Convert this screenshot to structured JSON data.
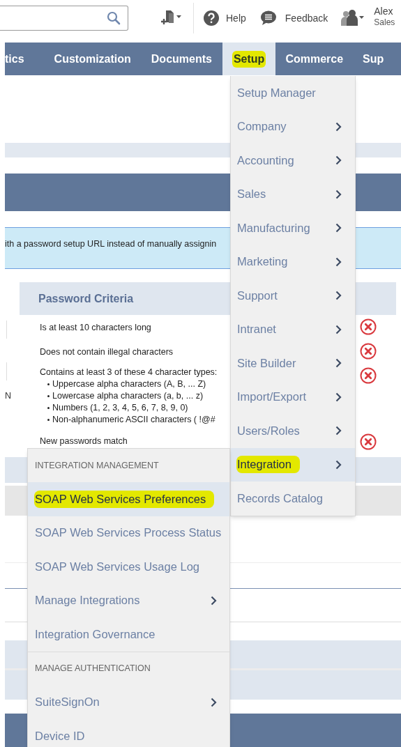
{
  "header": {
    "help_label": "Help",
    "feedback_label": "Feedback",
    "user_name": "Alex",
    "user_account": "Sales"
  },
  "nav": [
    {
      "label": "tics",
      "selected": false,
      "highlighted": false
    },
    {
      "label": "Customization",
      "selected": false,
      "highlighted": false
    },
    {
      "label": "Documents",
      "selected": false,
      "highlighted": false
    },
    {
      "label": "Setup",
      "selected": true,
      "highlighted": true
    },
    {
      "label": "Commerce",
      "selected": false,
      "highlighted": false
    },
    {
      "label": "Sup",
      "selected": false,
      "highlighted": false
    }
  ],
  "notice": {
    "text": "ith a password setup URL instead of manually assignin"
  },
  "left_label": "N",
  "password_criteria": {
    "title": "Password Criteria",
    "items": [
      {
        "text": "Is at least 10 characters long",
        "met": false
      },
      {
        "text": "Does not contain illegal characters",
        "met": false
      },
      {
        "text": "Contains at least 3 of these 4 character types:",
        "met": false,
        "children": [
          {
            "text": "Uppercase alpha characters (A, B, ... Z)"
          },
          {
            "text": "Lowercase alpha characters (a, b, ... z)"
          },
          {
            "text": "Numbers (1, 2, 3, 4, 5, 6, 7, 8, 9, 0)"
          },
          {
            "text": "Non-alphanumeric ASCII characters ( !@#"
          }
        ]
      },
      {
        "text": "New passwords match",
        "met": false
      }
    ]
  },
  "setup_menu": [
    {
      "label": "Setup Manager",
      "submenu": false,
      "selected": false,
      "highlighted": false
    },
    {
      "label": "Company",
      "submenu": true,
      "selected": false,
      "highlighted": false
    },
    {
      "label": "Accounting",
      "submenu": true,
      "selected": false,
      "highlighted": false
    },
    {
      "label": "Sales",
      "submenu": true,
      "selected": false,
      "highlighted": false
    },
    {
      "label": "Manufacturing",
      "submenu": true,
      "selected": false,
      "highlighted": false
    },
    {
      "label": "Marketing",
      "submenu": true,
      "selected": false,
      "highlighted": false
    },
    {
      "label": "Support",
      "submenu": true,
      "selected": false,
      "highlighted": false
    },
    {
      "label": "Intranet",
      "submenu": true,
      "selected": false,
      "highlighted": false
    },
    {
      "label": "Site Builder",
      "submenu": true,
      "selected": false,
      "highlighted": false
    },
    {
      "label": "Import/Export",
      "submenu": true,
      "selected": false,
      "highlighted": false
    },
    {
      "label": "Users/Roles",
      "submenu": true,
      "selected": false,
      "highlighted": false
    },
    {
      "label": "Integration",
      "submenu": true,
      "selected": true,
      "highlighted": true
    },
    {
      "label": "Records Catalog",
      "submenu": false,
      "selected": false,
      "highlighted": false
    }
  ],
  "integration_menu": {
    "sections": [
      {
        "header": "INTEGRATION MANAGEMENT",
        "items": [
          {
            "label": "SOAP Web Services Preferences",
            "submenu": false,
            "selected": true,
            "highlighted": true
          },
          {
            "label": "SOAP Web Services Process Status",
            "submenu": false,
            "selected": false,
            "highlighted": false
          },
          {
            "label": "SOAP Web Services Usage Log",
            "submenu": false,
            "selected": false,
            "highlighted": false
          },
          {
            "label": "Manage Integrations",
            "submenu": true,
            "selected": false,
            "highlighted": false
          },
          {
            "label": "Integration Governance",
            "submenu": false,
            "selected": false,
            "highlighted": false
          }
        ]
      },
      {
        "header": "MANAGE AUTHENTICATION",
        "items": [
          {
            "label": "SuiteSignOn",
            "submenu": true,
            "selected": false,
            "highlighted": false
          },
          {
            "label": "Device ID",
            "submenu": false,
            "selected": false,
            "highlighted": false
          }
        ]
      }
    ]
  }
}
